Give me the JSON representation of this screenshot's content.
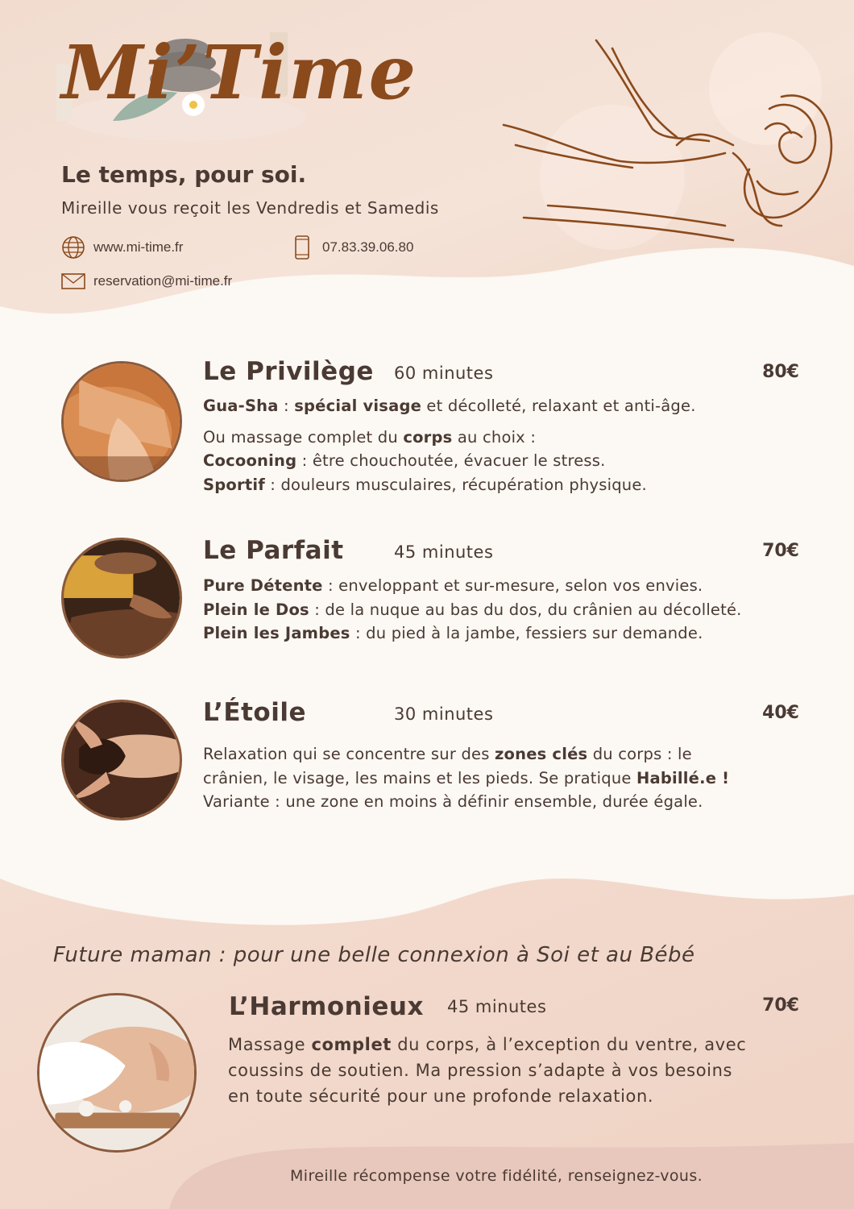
{
  "brand": {
    "logo_text": "Mi’Time",
    "tagline": "Le temps, pour soi.",
    "subtitle": "Mireille vous reçoit les Vendredis et Samedis"
  },
  "contact": {
    "website": "www.mi-time.fr",
    "phone": "07.83.39.06.80",
    "email": "reservation@mi-time.fr",
    "icons": [
      "globe-icon",
      "phone-icon",
      "envelope-icon"
    ]
  },
  "colors": {
    "accent": "#8a4a1c",
    "text": "#4a3a33",
    "background": "#fcf8f3",
    "wave": "#f3ddd0"
  },
  "services": [
    {
      "title": "Le Privilège",
      "duration": "60 minutes",
      "price": "80€",
      "lines": [
        [
          {
            "b": "Gua-Sha"
          },
          {
            "t": " : "
          },
          {
            "b": "spécial visage"
          },
          {
            "t": " et décolleté, relaxant et anti-âge."
          }
        ],
        [
          {
            "t": "Ou massage complet du "
          },
          {
            "b": "corps"
          },
          {
            "t": " au choix :"
          }
        ],
        [
          {
            "b": "Cocooning"
          },
          {
            "t": " : être chouchoutée, évacuer le stress."
          }
        ],
        [
          {
            "b": "Sportif"
          },
          {
            "t": " : douleurs musculaires, récupération physique."
          }
        ]
      ]
    },
    {
      "title": "Le Parfait",
      "duration": "45 minutes",
      "price": "70€",
      "lines": [
        [
          {
            "b": "Pure Détente"
          },
          {
            "t": " : enveloppant et sur-mesure, selon vos envies."
          }
        ],
        [
          {
            "b": "Plein le Dos"
          },
          {
            "t": " : de la nuque au bas du dos, du crânien au décolleté."
          }
        ],
        [
          {
            "b": "Plein les Jambes"
          },
          {
            "t": " : du pied à la jambe, fessiers sur demande."
          }
        ]
      ]
    },
    {
      "title": "L’Étoile",
      "duration": "30 minutes",
      "price": "40€",
      "lines": [
        [
          {
            "t": "Relaxation qui se concentre sur des "
          },
          {
            "b": "zones clés"
          },
          {
            "t": " du corps : le"
          }
        ],
        [
          {
            "t": "crânien, le visage, les mains et les pieds. Se pratique "
          },
          {
            "b": "Habillé.e !"
          }
        ],
        [
          {
            "t": "Variante : une zone en moins à définir ensemble, durée égale."
          }
        ]
      ]
    }
  ],
  "future_heading": "Future maman : pour une belle connexion à Soi et au Bébé",
  "harmonieux": {
    "title": "L’Harmonieux",
    "duration": "45 minutes",
    "price": "70€",
    "lines": [
      [
        {
          "t": "Massage "
        },
        {
          "b": "complet"
        },
        {
          "t": " du corps, à l’exception du ventre, avec"
        }
      ],
      [
        {
          "t": "coussins de soutien. Ma pression s’adapte à vos besoins"
        }
      ],
      [
        {
          "t": "en toute sécurité pour une profonde relaxation."
        }
      ]
    ]
  },
  "loyalty": "Mireille récompense votre fidélité, renseignez-vous."
}
